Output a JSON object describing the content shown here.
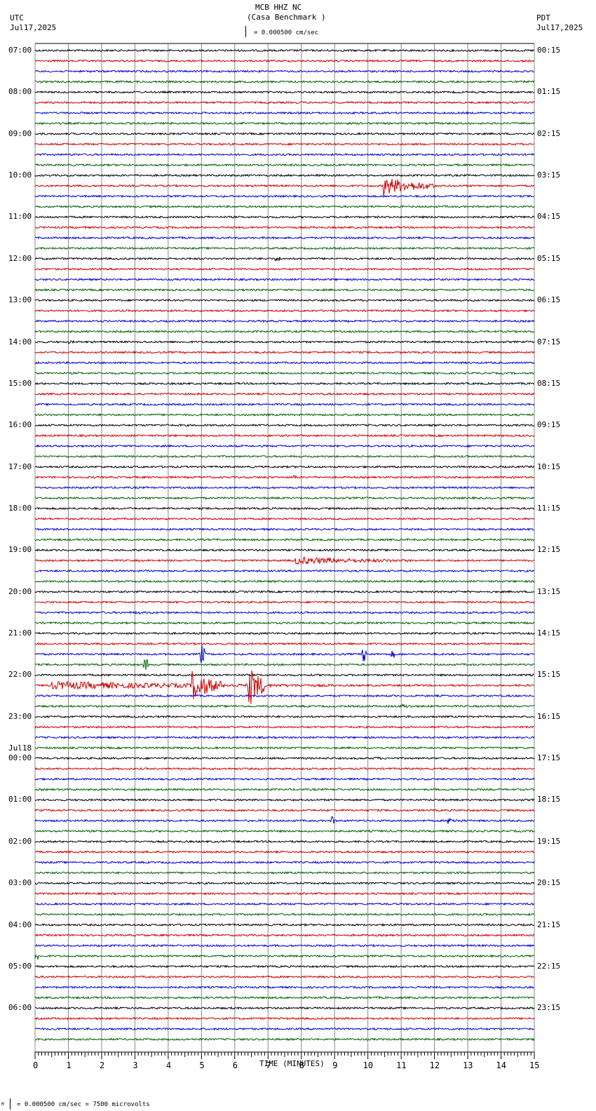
{
  "header": {
    "station": "MCB HHZ NC",
    "site": "(Casa Benchmark )",
    "left_tz": "UTC",
    "left_date": "Jul17,2025",
    "right_tz": "PDT",
    "right_date": "Jul17,2025",
    "scale": "= 0.000500 cm/sec"
  },
  "footer": {
    "scale": "= 0.000500 cm/sec =    7500 microvolts",
    "scale_mark": "M"
  },
  "chart_data": {
    "type": "line",
    "title": "MCB HHZ NC (Casa Benchmark )",
    "xlabel": "TIME (MINUTES)",
    "xlim": [
      0,
      15
    ],
    "xticks": [
      "0",
      "1",
      "2",
      "3",
      "4",
      "5",
      "6",
      "7",
      "8",
      "9",
      "10",
      "11",
      "12",
      "13",
      "14",
      "15"
    ],
    "trace_colors": [
      "#000000",
      "#d00000",
      "#0000d0",
      "#006000"
    ],
    "trace_count": 96,
    "left_labels": [
      "07:00",
      "08:00",
      "09:00",
      "10:00",
      "11:00",
      "12:00",
      "13:00",
      "14:00",
      "15:00",
      "16:00",
      "17:00",
      "18:00",
      "19:00",
      "20:00",
      "21:00",
      "22:00",
      "23:00",
      "00:00",
      "01:00",
      "02:00",
      "03:00",
      "04:00",
      "05:00",
      "06:00"
    ],
    "date_change_label": "Jul18",
    "right_labels": [
      "00:15",
      "01:15",
      "02:15",
      "03:15",
      "04:15",
      "05:15",
      "06:15",
      "07:15",
      "08:15",
      "09:15",
      "10:15",
      "11:15",
      "12:15",
      "13:15",
      "14:15",
      "15:15",
      "16:15",
      "17:15",
      "18:15",
      "19:15",
      "20:15",
      "21:15",
      "22:15",
      "23:15"
    ],
    "events": [
      {
        "trace": 13,
        "start": 10.45,
        "end": 12.0,
        "amp": 12
      },
      {
        "trace": 20,
        "start": 7.2,
        "end": 7.4,
        "amp": 3
      },
      {
        "trace": 28,
        "start": 1.0,
        "end": 1.6,
        "amp": 2
      },
      {
        "trace": 41,
        "start": 7.75,
        "end": 7.85,
        "amp": 4
      },
      {
        "trace": 49,
        "start": 7.8,
        "end": 11.3,
        "amp": 5
      },
      {
        "trace": 54,
        "start": 3.0,
        "end": 4.0,
        "amp": 2
      },
      {
        "trace": 58,
        "start": 4.95,
        "end": 5.1,
        "amp": 14
      },
      {
        "trace": 58,
        "start": 9.8,
        "end": 9.95,
        "amp": 10
      },
      {
        "trace": 58,
        "start": 10.7,
        "end": 10.8,
        "amp": 5
      },
      {
        "trace": 59,
        "start": 3.25,
        "end": 3.4,
        "amp": 8
      },
      {
        "trace": 61,
        "start": 0.5,
        "end": 9.0,
        "amp": 5
      },
      {
        "trace": 61,
        "start": 4.7,
        "end": 5.6,
        "amp": 20
      },
      {
        "trace": 61,
        "start": 6.4,
        "end": 6.9,
        "amp": 30
      },
      {
        "trace": 63,
        "start": 11.0,
        "end": 11.7,
        "amp": 3
      },
      {
        "trace": 68,
        "start": 10.2,
        "end": 10.5,
        "amp": 3
      },
      {
        "trace": 74,
        "start": 8.9,
        "end": 9.0,
        "amp": 7
      },
      {
        "trace": 74,
        "start": 12.4,
        "end": 13.0,
        "amp": 4
      },
      {
        "trace": 87,
        "start": 0.0,
        "end": 0.1,
        "amp": 6
      }
    ]
  }
}
